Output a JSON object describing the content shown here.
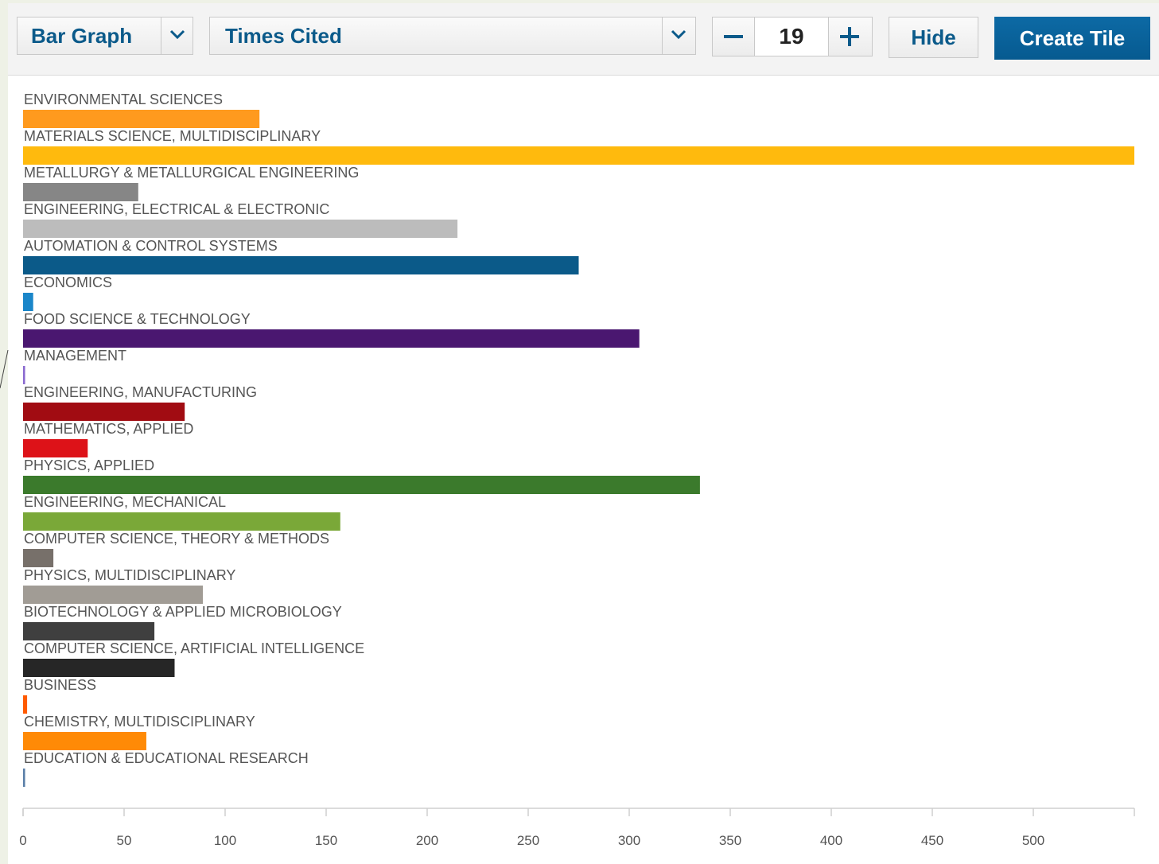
{
  "toolbar": {
    "chart_type": "Bar Graph",
    "metric": "Times Cited",
    "count": "19",
    "hide_label": "Hide",
    "create_label": "Create Tile"
  },
  "chart_data": {
    "type": "bar",
    "orientation": "horizontal",
    "xlim": [
      0,
      550
    ],
    "xticks": [
      0,
      50,
      100,
      150,
      200,
      250,
      300,
      350,
      400,
      450,
      500
    ],
    "categories": [
      "ENVIRONMENTAL SCIENCES",
      "MATERIALS SCIENCE, MULTIDISCIPLINARY",
      "METALLURGY & METALLURGICAL ENGINEERING",
      "ENGINEERING, ELECTRICAL & ELECTRONIC",
      "AUTOMATION & CONTROL SYSTEMS",
      "ECONOMICS",
      "FOOD SCIENCE & TECHNOLOGY",
      "MANAGEMENT",
      "ENGINEERING, MANUFACTURING",
      "MATHEMATICS, APPLIED",
      "PHYSICS, APPLIED",
      "ENGINEERING, MECHANICAL",
      "COMPUTER SCIENCE, THEORY & METHODS",
      "PHYSICS, MULTIDISCIPLINARY",
      "BIOTECHNOLOGY & APPLIED MICROBIOLOGY",
      "COMPUTER SCIENCE, ARTIFICIAL INTELLIGENCE",
      "BUSINESS",
      "CHEMISTRY, MULTIDISCIPLINARY",
      "EDUCATION & EDUCATIONAL RESEARCH"
    ],
    "values": [
      117,
      550,
      57,
      215,
      275,
      5,
      305,
      1,
      80,
      32,
      335,
      157,
      15,
      89,
      65,
      75,
      2,
      61,
      1
    ],
    "colors": [
      "#ff9a1e",
      "#ffba0d",
      "#868686",
      "#bcbcbc",
      "#0b5a89",
      "#1a86c9",
      "#4a1770",
      "#8a6ad0",
      "#a10c12",
      "#dd1218",
      "#3b7a2c",
      "#7aa838",
      "#77706a",
      "#a19c95",
      "#3f3f3f",
      "#262626",
      "#ff5a00",
      "#ff8a06",
      "#5a7fa8"
    ],
    "grid": false,
    "legend": "none"
  }
}
